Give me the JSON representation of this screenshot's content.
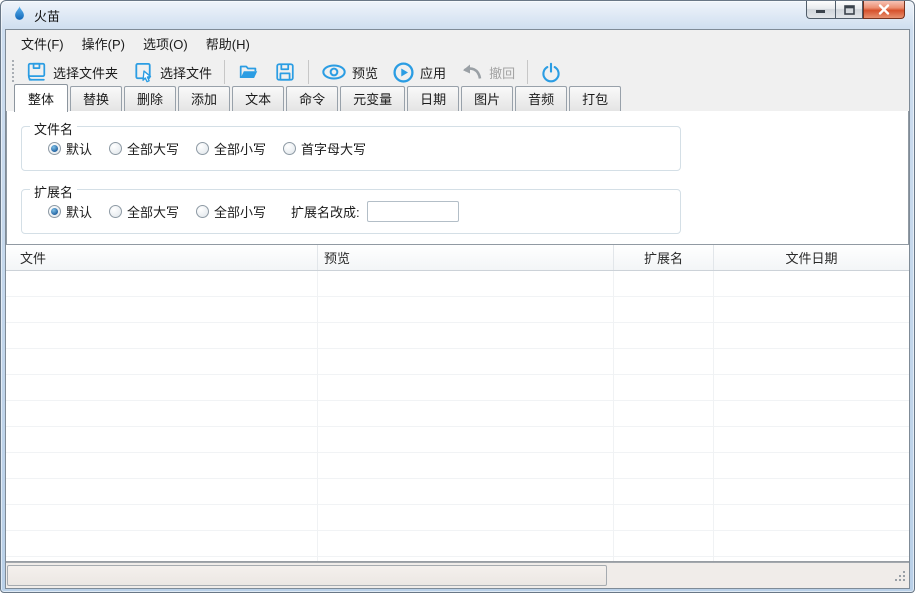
{
  "window": {
    "title": "火苗",
    "controls": {
      "minimize": "minimize",
      "maximize": "maximize",
      "close": "close"
    }
  },
  "menu": {
    "items": [
      {
        "label": "文件(F)"
      },
      {
        "label": "操作(P)"
      },
      {
        "label": "选项(O)"
      },
      {
        "label": "帮助(H)"
      }
    ]
  },
  "toolbar": {
    "select_folder_label": "选择文件夹",
    "select_file_label": "选择文件",
    "preview_label": "预览",
    "apply_label": "应用",
    "undo_label": "撤回",
    "undo_disabled": true,
    "icons": [
      "folder-book-icon",
      "file-cursor-icon",
      "open-folder-icon",
      "save-icon",
      "eye-icon",
      "play-icon",
      "undo-icon",
      "power-icon"
    ]
  },
  "tabs": {
    "items": [
      {
        "label": "整体",
        "active": true
      },
      {
        "label": "替换",
        "active": false
      },
      {
        "label": "删除",
        "active": false
      },
      {
        "label": "添加",
        "active": false
      },
      {
        "label": "文本",
        "active": false
      },
      {
        "label": "命令",
        "active": false
      },
      {
        "label": "元变量",
        "active": false
      },
      {
        "label": "日期",
        "active": false
      },
      {
        "label": "图片",
        "active": false
      },
      {
        "label": "音频",
        "active": false
      },
      {
        "label": "打包",
        "active": false
      }
    ]
  },
  "panel": {
    "filename_group": {
      "title": "文件名",
      "options": [
        {
          "label": "默认",
          "selected": true
        },
        {
          "label": "全部大写",
          "selected": false
        },
        {
          "label": "全部小写",
          "selected": false
        },
        {
          "label": "首字母大写",
          "selected": false
        }
      ]
    },
    "extension_group": {
      "title": "扩展名",
      "options": [
        {
          "label": "默认",
          "selected": true
        },
        {
          "label": "全部大写",
          "selected": false
        },
        {
          "label": "全部小写",
          "selected": false
        }
      ],
      "change_label": "扩展名改成:",
      "change_value": ""
    }
  },
  "table": {
    "columns": [
      {
        "label": "文件"
      },
      {
        "label": "预览"
      },
      {
        "label": "扩展名"
      },
      {
        "label": "文件日期"
      }
    ],
    "rows": []
  },
  "colors": {
    "accent_blue": "#2b9de3",
    "disabled_gray": "#9aa0a5",
    "close_button_red": "#d6512c",
    "frame_blue": "#b9d0e8"
  }
}
